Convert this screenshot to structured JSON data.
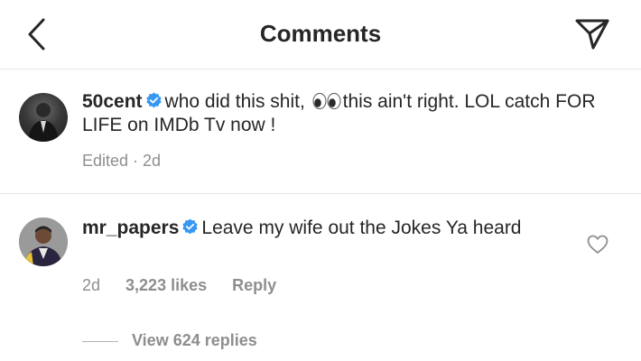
{
  "header": {
    "title": "Comments",
    "back_icon": "chevron-left-icon",
    "share_icon": "paper-plane-icon"
  },
  "comments": [
    {
      "username": "50cent",
      "verified": true,
      "text_before_emoji": "who did this shit, ",
      "emoji": "👀",
      "text_after_emoji": "this ain't right. LOL catch FOR LIFE on IMDb Tv now !",
      "meta": "Edited · 2d"
    },
    {
      "username": "mr_papers",
      "verified": true,
      "text": "Leave my wife out the Jokes Ya heard",
      "time": "2d",
      "likes": "3,223 likes",
      "reply_label": "Reply",
      "view_replies": "View 624 replies"
    }
  ],
  "colors": {
    "text": "#262626",
    "secondary": "#8e8e8e",
    "verified_blue": "#3897f0",
    "divider": "#e6e6e6"
  }
}
